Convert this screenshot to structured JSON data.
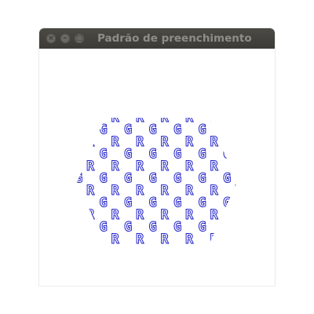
{
  "window": {
    "title": "Padrão de preenchimento",
    "buttons": {
      "close_icon": "close-icon",
      "minimize_icon": "minimize-icon",
      "maximize_icon": "maximize-icon"
    }
  },
  "pattern": {
    "shape": "hexagon",
    "fill_color": "#1f1fc8",
    "glyph_rows": [
      {
        "letter": "R"
      },
      {
        "letter": "G"
      },
      {
        "letter": "R"
      },
      {
        "letter": "G"
      },
      {
        "letter": "R"
      },
      {
        "letter": "G"
      },
      {
        "letter": "R"
      },
      {
        "letter": "G"
      },
      {
        "letter": "R"
      },
      {
        "letter": "G"
      },
      {
        "letter": "R"
      }
    ]
  }
}
